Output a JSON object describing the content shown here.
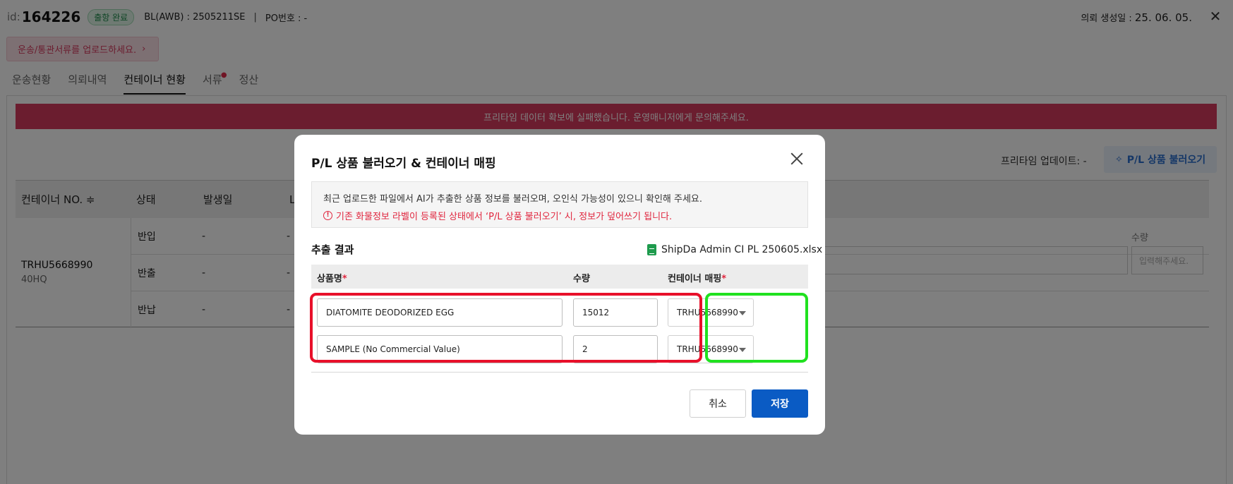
{
  "header": {
    "id_label": "id:",
    "id_value": "164226",
    "status_badge": "출항 완료",
    "bl": "BL(AWB) : 2505211SE",
    "separator": "|",
    "po": "PO번호 : -",
    "created_label": "의뢰 생성일 : ",
    "created_value": "25. 06. 05.",
    "close_icon": "close-icon"
  },
  "upload_banner": {
    "text": "운송/통관서류를 업로드하세요.",
    "chevron": "›"
  },
  "tabs": [
    {
      "label": "운송현황",
      "active": false
    },
    {
      "label": "의뢰내역",
      "active": false
    },
    {
      "label": "컨테이너 현황",
      "active": true
    },
    {
      "label": "서류",
      "active": false,
      "dot": "●"
    },
    {
      "label": "정산",
      "active": false
    }
  ],
  "error_message": "프리타임 데이터 확보에 실패했습니다. 운영매니저에게 문의해주세요.",
  "freetime_update": "프리타임 업데이트: -",
  "pl_load_button": "P/L 상품 불러오기",
  "container_table": {
    "headers": [
      "컨테이너 NO. ≑",
      "상태",
      "발생일",
      "L"
    ],
    "container_no": "TRHU5668990",
    "container_type": "40HQ",
    "rows": [
      {
        "status": "반입",
        "date": "-",
        "extra": "-"
      },
      {
        "status": "반출",
        "date": "-",
        "extra": "-"
      },
      {
        "status": "반납",
        "date": "-",
        "extra": "-"
      }
    ],
    "qty_label": "수량",
    "qty_placeholder": "입력해주세요."
  },
  "modal": {
    "title": "P/L 상품 불러오기 & 컨테이너 매핑",
    "info_line1": "최근 업로드한 파일에서 AI가 추출한 상품 정보를 불러오며, 오인식 가능성이 있으니 확인해 주세요.",
    "info_line2": "기존 화물정보 라벨이 등록된 상태에서 ‘P/L 상품 불러오기’ 시, 정보가 덮어쓰기 됩니다.",
    "warn_icon": "!",
    "result_title": "추출 결과",
    "file_name": "ShipDa Admin CI PL 250605.xlsx",
    "col_product": "상품명",
    "col_qty": "수량",
    "col_container": "컨테이너 매핑",
    "required_mark": "*",
    "items": [
      {
        "product": "DIATOMITE DEODORIZED EGG",
        "qty": "15012",
        "container": "TRHU5668990"
      },
      {
        "product": "SAMPLE (No Commercial Value)",
        "qty": "2",
        "container": "TRHU5668990"
      }
    ],
    "cancel_label": "취소",
    "save_label": "저장"
  },
  "colors": {
    "error_bar": "#d63a5e",
    "save_button": "#0a5bc4",
    "highlight_red": "#e8102a",
    "highlight_green": "#20e11f"
  }
}
